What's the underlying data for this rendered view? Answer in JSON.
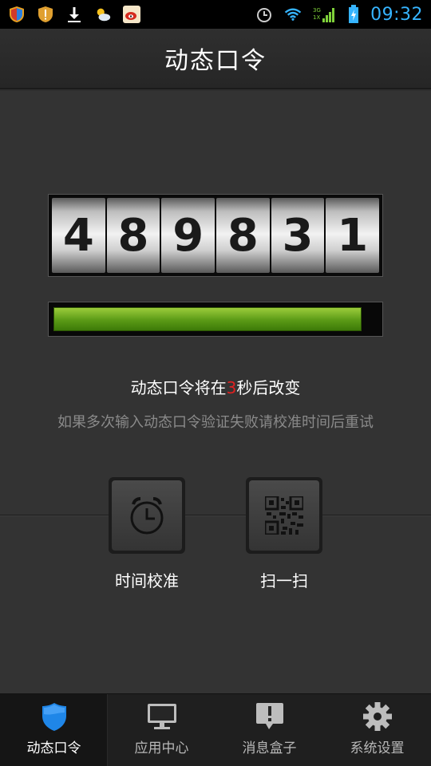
{
  "status_bar": {
    "time": "09:32",
    "left_icons": [
      "shield-icon",
      "shield-alert-icon",
      "download-icon",
      "weather-icon",
      "weibo-icon"
    ],
    "right_icons": [
      "alarm-icon",
      "wifi-icon",
      "signal-icon",
      "battery-icon"
    ],
    "network_label_top": "3G",
    "network_label_bottom": "1X"
  },
  "header": {
    "title": "动态口令"
  },
  "token": {
    "digits": [
      "4",
      "8",
      "9",
      "8",
      "3",
      "1"
    ],
    "progress": 0.95
  },
  "countdown": {
    "prefix": "动态口令将在",
    "seconds": "3",
    "suffix": "秒后改变"
  },
  "hint": "如果多次输入动态口令验证失败请校准时间后重试",
  "actions": {
    "time_sync_label": "时间校准",
    "scan_label": "扫一扫"
  },
  "tabs": [
    {
      "label": "动态口令",
      "icon": "shield-icon",
      "active": true
    },
    {
      "label": "应用中心",
      "icon": "monitor-icon",
      "active": false
    },
    {
      "label": "消息盒子",
      "icon": "message-icon",
      "active": false
    },
    {
      "label": "系统设置",
      "icon": "gear-icon",
      "active": false
    }
  ],
  "colors": {
    "accent_blue": "#36b4ff",
    "countdown_red": "#e02020",
    "progress_green": "#5a9a16"
  }
}
